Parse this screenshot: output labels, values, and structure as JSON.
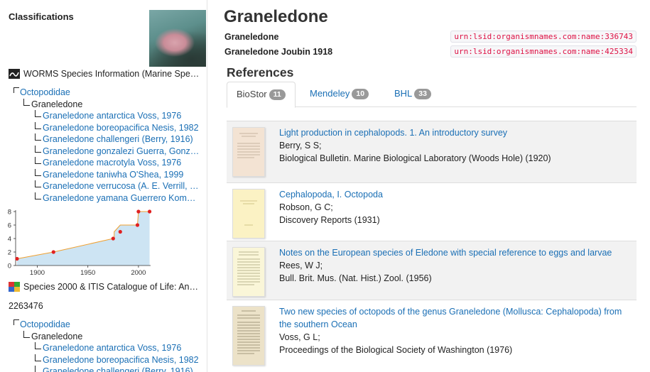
{
  "sidebar": {
    "title": "Classifications",
    "worms": {
      "label": "WORMS Species Information (Marine Spe…",
      "icon": "worms-logo-icon",
      "tree": {
        "family": "Octopodidae",
        "genus": "Graneledone",
        "species": [
          "Graneledone antarctica Voss, 1976",
          "Graneledone boreopacifica Nesis, 1982",
          "Graneledone challengeri (Berry, 1916)",
          "Graneledone gonzalezi Guerra, Gonz…",
          "Graneledone macrotyla Voss, 1976",
          "Graneledone taniwha O'Shea, 1999",
          "Graneledone verrucosa (A. E. Verrill, …",
          "Graneledone yamana Guerrero Kom…"
        ]
      }
    },
    "col": {
      "label": "Species 2000 & ITIS Catalogue of Life: An…",
      "icon": "catalogue-of-life-icon",
      "id": "2263476",
      "tree": {
        "family": "Octopodidae",
        "genus": "Graneledone",
        "species": [
          "Graneledone antarctica Voss, 1976",
          "Graneledone boreopacifica Nesis, 1982",
          "Graneledone challengeri (Berry, 1916)"
        ]
      }
    }
  },
  "chart_data": {
    "type": "area",
    "x": [
      1880,
      1916,
      1975,
      1976,
      1976,
      1982,
      1999,
      2000,
      2011
    ],
    "y": [
      1,
      2,
      4,
      4,
      5,
      6,
      6,
      8,
      8
    ],
    "points_x": [
      1880,
      1916,
      1975,
      1982,
      1999,
      2000,
      2011
    ],
    "points_y": [
      1,
      2,
      4,
      5,
      6,
      8,
      8
    ],
    "xticks": [
      "1900",
      "1950",
      "2000"
    ],
    "yticks": [
      "0",
      "2",
      "4",
      "6",
      "8"
    ],
    "xlim": [
      1880,
      2012
    ],
    "ylim": [
      0,
      8
    ],
    "fill_color": "#cde4f3",
    "line_color": "#f0a030",
    "point_color": "#e02020"
  },
  "main": {
    "title": "Graneledone",
    "names": [
      {
        "name": "Graneledone",
        "lsid": "urn:lsid:organismnames.com:name:336743"
      },
      {
        "name": "Graneledone Joubin 1918",
        "lsid": "urn:lsid:organismnames.com:name:425334"
      }
    ],
    "references_heading": "References",
    "tabs": [
      {
        "label": "BioStor",
        "count": "11"
      },
      {
        "label": "Mendeley",
        "count": "10"
      },
      {
        "label": "BHL",
        "count": "33"
      }
    ],
    "references": [
      {
        "title": "Light production in cephalopods. 1. An introductory survey",
        "authors": "Berry, S S;",
        "journal": "Biological Bulletin. Marine Biological Laboratory (Woods Hole) (1920)"
      },
      {
        "title": "Cephalopoda, I. Octopoda",
        "authors": "Robson, G C;",
        "journal": "Discovery Reports (1931)"
      },
      {
        "title": "Notes on the European species of Eledone with special reference to eggs and larvae",
        "authors": "Rees, W J;",
        "journal": "Bull. Brit. Mus. (Nat. Hist.) Zool. (1956)"
      },
      {
        "title": "Two new species of octopods of the genus Graneledone (Mollusca: Cephalopoda) from the southern Ocean",
        "authors": "Voss, G L;",
        "journal": "Proceedings of the Biological Society of Washington (1976)"
      }
    ]
  }
}
